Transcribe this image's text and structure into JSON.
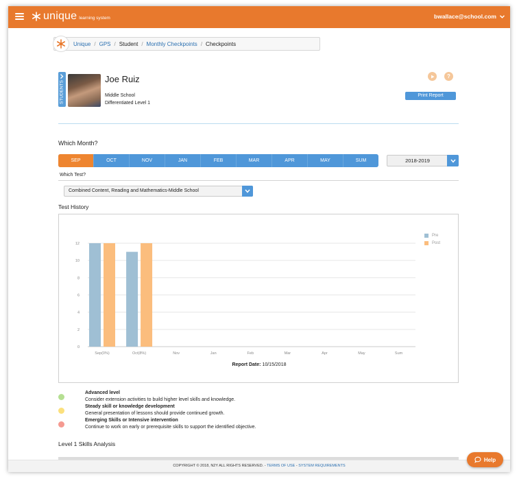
{
  "app": {
    "brand": "unique",
    "brand_sub": "learning system",
    "user_email": "bwallace@school.com"
  },
  "breadcrumb": {
    "items": [
      {
        "label": "Unique",
        "link": true
      },
      {
        "label": "GPS",
        "link": true
      },
      {
        "label": "Student",
        "link": false
      },
      {
        "label": "Monthly Checkpoints",
        "link": true
      },
      {
        "label": "Checkpoints",
        "link": false
      }
    ],
    "separator": "/"
  },
  "student": {
    "tab_label": "STUDENTS",
    "name": "Joe Ruiz",
    "grade": "Middle School",
    "level": "Differentiated Level 1",
    "print_label": "Print Report"
  },
  "month_selector": {
    "heading": "Which Month?",
    "months": [
      "SEP",
      "OCT",
      "NOV",
      "JAN",
      "FEB",
      "MAR",
      "APR",
      "MAY",
      "SUM"
    ],
    "active": "SEP",
    "year": "2018-2019"
  },
  "test_selector": {
    "heading": "Which Test?",
    "selected": "Combined Content, Reading and Mathematics-Middle School"
  },
  "test_history": {
    "heading": "Test History",
    "report_date_label": "Report Date:",
    "report_date": "10/15/2018"
  },
  "chart_data": {
    "type": "bar",
    "categories": [
      "Sep(0%)",
      "Oct(8%)",
      "Nov",
      "Jan",
      "Feb",
      "Mar",
      "Apr",
      "May",
      "Sum"
    ],
    "series": [
      {
        "name": "Pre",
        "color": "#9fbfd4",
        "values": [
          12,
          11,
          null,
          null,
          null,
          null,
          null,
          null,
          null
        ]
      },
      {
        "name": "Post",
        "color": "#fbbd7d",
        "values": [
          12,
          12,
          null,
          null,
          null,
          null,
          null,
          null,
          null
        ]
      }
    ],
    "yticks": [
      0,
      2,
      4,
      6,
      8,
      10,
      12
    ],
    "ylim": [
      0,
      12
    ],
    "grid": true,
    "legend": "top-right"
  },
  "key": [
    {
      "title": "Advanced level",
      "desc": "Consider extension activities to build higher level skills and knowledge.",
      "color": "#b5df92"
    },
    {
      "title": "Steady skill or knowledge development",
      "desc": "General presentation of lessons should provide continued growth.",
      "color": "#fbe07d"
    },
    {
      "title": "Emerging Skills or Intensive intervention",
      "desc": "Continue to work on early or prerequisite skills to support the identified objective.",
      "color": "#f59a91"
    }
  ],
  "skills": {
    "heading": "Level 1 Skills Analysis"
  },
  "footer": {
    "copyright": "COPYRIGHT © 2018, N2Y ALL RIGHTS RESERVED.",
    "terms": "TERMS OF USE",
    "requirements": "SYSTEM REQUIREMENTS"
  },
  "help": {
    "label": "Help"
  }
}
